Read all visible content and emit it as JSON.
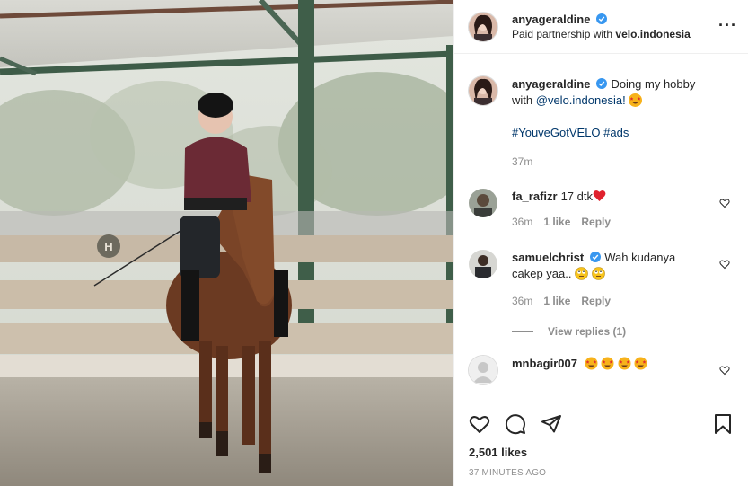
{
  "post": {
    "author": "anyageraldine",
    "partnership_prefix": "Paid partnership with",
    "partner": "velo.indonesia",
    "more_icon": "more-horizontal-icon"
  },
  "caption": {
    "username": "anyageraldine",
    "text": "Doing my hobby with",
    "mention": "@velo.indonesia!",
    "hashtags": "#YouveGotVELO #ads",
    "time": "37m"
  },
  "comments": [
    {
      "username": "fa_rafizr",
      "text": "17 dtk",
      "time": "36m",
      "likes": "1 like",
      "reply": "Reply"
    },
    {
      "username": "samuelchrist",
      "text": "Wah kudanya cakep yaa..",
      "time": "36m",
      "likes": "1 like",
      "reply": "Reply",
      "view_replies": "View replies (1)"
    },
    {
      "username": "mnbagir007",
      "text": ""
    }
  ],
  "footer": {
    "likes": "2,501 likes",
    "posted": "37 MINUTES AGO",
    "icons": [
      "heart-icon",
      "comment-icon",
      "share-icon",
      "bookmark-icon"
    ]
  },
  "colors": {
    "link": "#00376b",
    "muted": "#8e8e8e",
    "verified": "#3897f0",
    "text": "#262626"
  }
}
